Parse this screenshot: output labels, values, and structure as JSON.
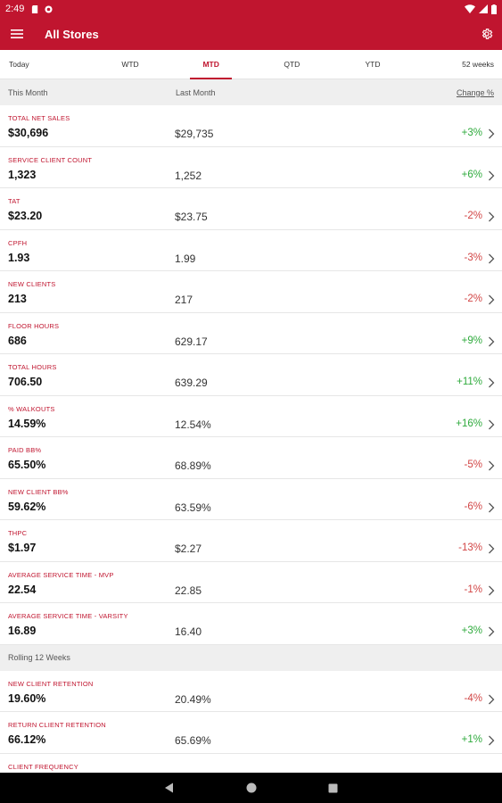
{
  "status_bar": {
    "time": "2:49"
  },
  "app_bar": {
    "title": "All Stores"
  },
  "tabs": [
    {
      "label": "Today",
      "active": false
    },
    {
      "label": "WTD",
      "active": false
    },
    {
      "label": "MTD",
      "active": true
    },
    {
      "label": "QTD",
      "active": false
    },
    {
      "label": "YTD",
      "active": false
    },
    {
      "label": "52 weeks",
      "active": false
    }
  ],
  "sections": [
    {
      "header": {
        "col1": "This Month",
        "col2": "Last Month",
        "col3": "Change %"
      },
      "rows": [
        {
          "label": "TOTAL NET SALES",
          "value": "$30,696",
          "last": "$29,735",
          "change": "+3%",
          "dir": "pos"
        },
        {
          "label": "SERVICE CLIENT COUNT",
          "value": "1,323",
          "last": "1,252",
          "change": "+6%",
          "dir": "pos"
        },
        {
          "label": "TAT",
          "value": "$23.20",
          "last": "$23.75",
          "change": "-2%",
          "dir": "neg"
        },
        {
          "label": "CPFH",
          "value": "1.93",
          "last": "1.99",
          "change": "-3%",
          "dir": "neg"
        },
        {
          "label": "NEW CLIENTS",
          "value": "213",
          "last": "217",
          "change": "-2%",
          "dir": "neg"
        },
        {
          "label": "FLOOR HOURS",
          "value": "686",
          "last": "629.17",
          "change": "+9%",
          "dir": "pos"
        },
        {
          "label": "TOTAL HOURS",
          "value": "706.50",
          "last": "639.29",
          "change": "+11%",
          "dir": "pos"
        },
        {
          "label": "% WALKOUTS",
          "value": "14.59%",
          "last": "12.54%",
          "change": "+16%",
          "dir": "pos"
        },
        {
          "label": "PAID BB%",
          "value": "65.50%",
          "last": "68.89%",
          "change": "-5%",
          "dir": "neg"
        },
        {
          "label": "NEW CLIENT BB%",
          "value": "59.62%",
          "last": "63.59%",
          "change": "-6%",
          "dir": "neg"
        },
        {
          "label": "THPC",
          "value": "$1.97",
          "last": "$2.27",
          "change": "-13%",
          "dir": "neg"
        },
        {
          "label": "AVERAGE SERVICE TIME - MVP",
          "value": "22.54",
          "last": "22.85",
          "change": "-1%",
          "dir": "neg"
        },
        {
          "label": "AVERAGE SERVICE TIME - VARSITY",
          "value": "16.89",
          "last": "16.40",
          "change": "+3%",
          "dir": "pos"
        }
      ]
    },
    {
      "header": {
        "col1": "Rolling 12 Weeks"
      },
      "rows": [
        {
          "label": "NEW CLIENT RETENTION",
          "value": "19.60%",
          "last": "20.49%",
          "change": "-4%",
          "dir": "neg"
        },
        {
          "label": "RETURN CLIENT RETENTION",
          "value": "66.12%",
          "last": "65.69%",
          "change": "+1%",
          "dir": "pos"
        },
        {
          "label": "CLIENT FREQUENCY"
        }
      ]
    }
  ],
  "colors": {
    "brand": "#c0152f",
    "positive": "#2eaa3c",
    "negative": "#d24545"
  },
  "icons": [
    "menu-icon",
    "settings-icon",
    "chevron-right-icon",
    "back-icon",
    "home-icon",
    "recents-icon"
  ]
}
